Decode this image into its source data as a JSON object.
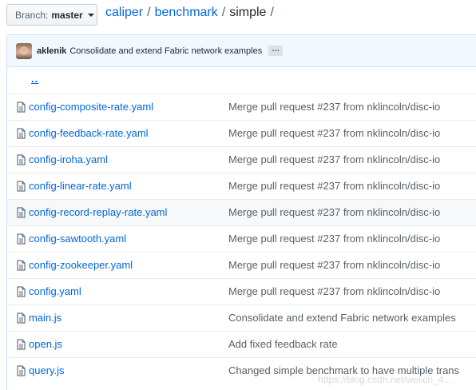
{
  "branch": {
    "prefix": "Branch:",
    "name": "master"
  },
  "breadcrumb": {
    "repo": "caliper",
    "dir": "benchmark",
    "current": "simple",
    "separator": "/"
  },
  "commit": {
    "author": "aklenik",
    "message": "Consolidate and extend Fabric network examples",
    "ellipsis": "…"
  },
  "parent_dir": "..",
  "files": [
    {
      "name": "config-composite-rate.yaml",
      "message": "Merge pull request #237 from nklincoln/disc-io"
    },
    {
      "name": "config-feedback-rate.yaml",
      "message": "Merge pull request #237 from nklincoln/disc-io"
    },
    {
      "name": "config-iroha.yaml",
      "message": "Merge pull request #237 from nklincoln/disc-io"
    },
    {
      "name": "config-linear-rate.yaml",
      "message": "Merge pull request #237 from nklincoln/disc-io"
    },
    {
      "name": "config-record-replay-rate.yaml",
      "message": "Merge pull request #237 from nklincoln/disc-io"
    },
    {
      "name": "config-sawtooth.yaml",
      "message": "Merge pull request #237 from nklincoln/disc-io"
    },
    {
      "name": "config-zookeeper.yaml",
      "message": "Merge pull request #237 from nklincoln/disc-io"
    },
    {
      "name": "config.yaml",
      "message": "Merge pull request #237 from nklincoln/disc-io"
    },
    {
      "name": "main.js",
      "message": "Consolidate and extend Fabric network examples"
    },
    {
      "name": "open.js",
      "message": "Add fixed feedback rate"
    },
    {
      "name": "query.js",
      "message": "Changed simple benchmark to have multiple trans"
    }
  ],
  "icons": {
    "file": "file-icon",
    "avatar": "avatar",
    "caret": "chevron-down-icon"
  },
  "colors": {
    "link": "#0366d6",
    "commit_bg": "#f1f8ff",
    "border": "#c8e1ff"
  },
  "watermark": "https://blog.csdn.net/weixin_4..."
}
